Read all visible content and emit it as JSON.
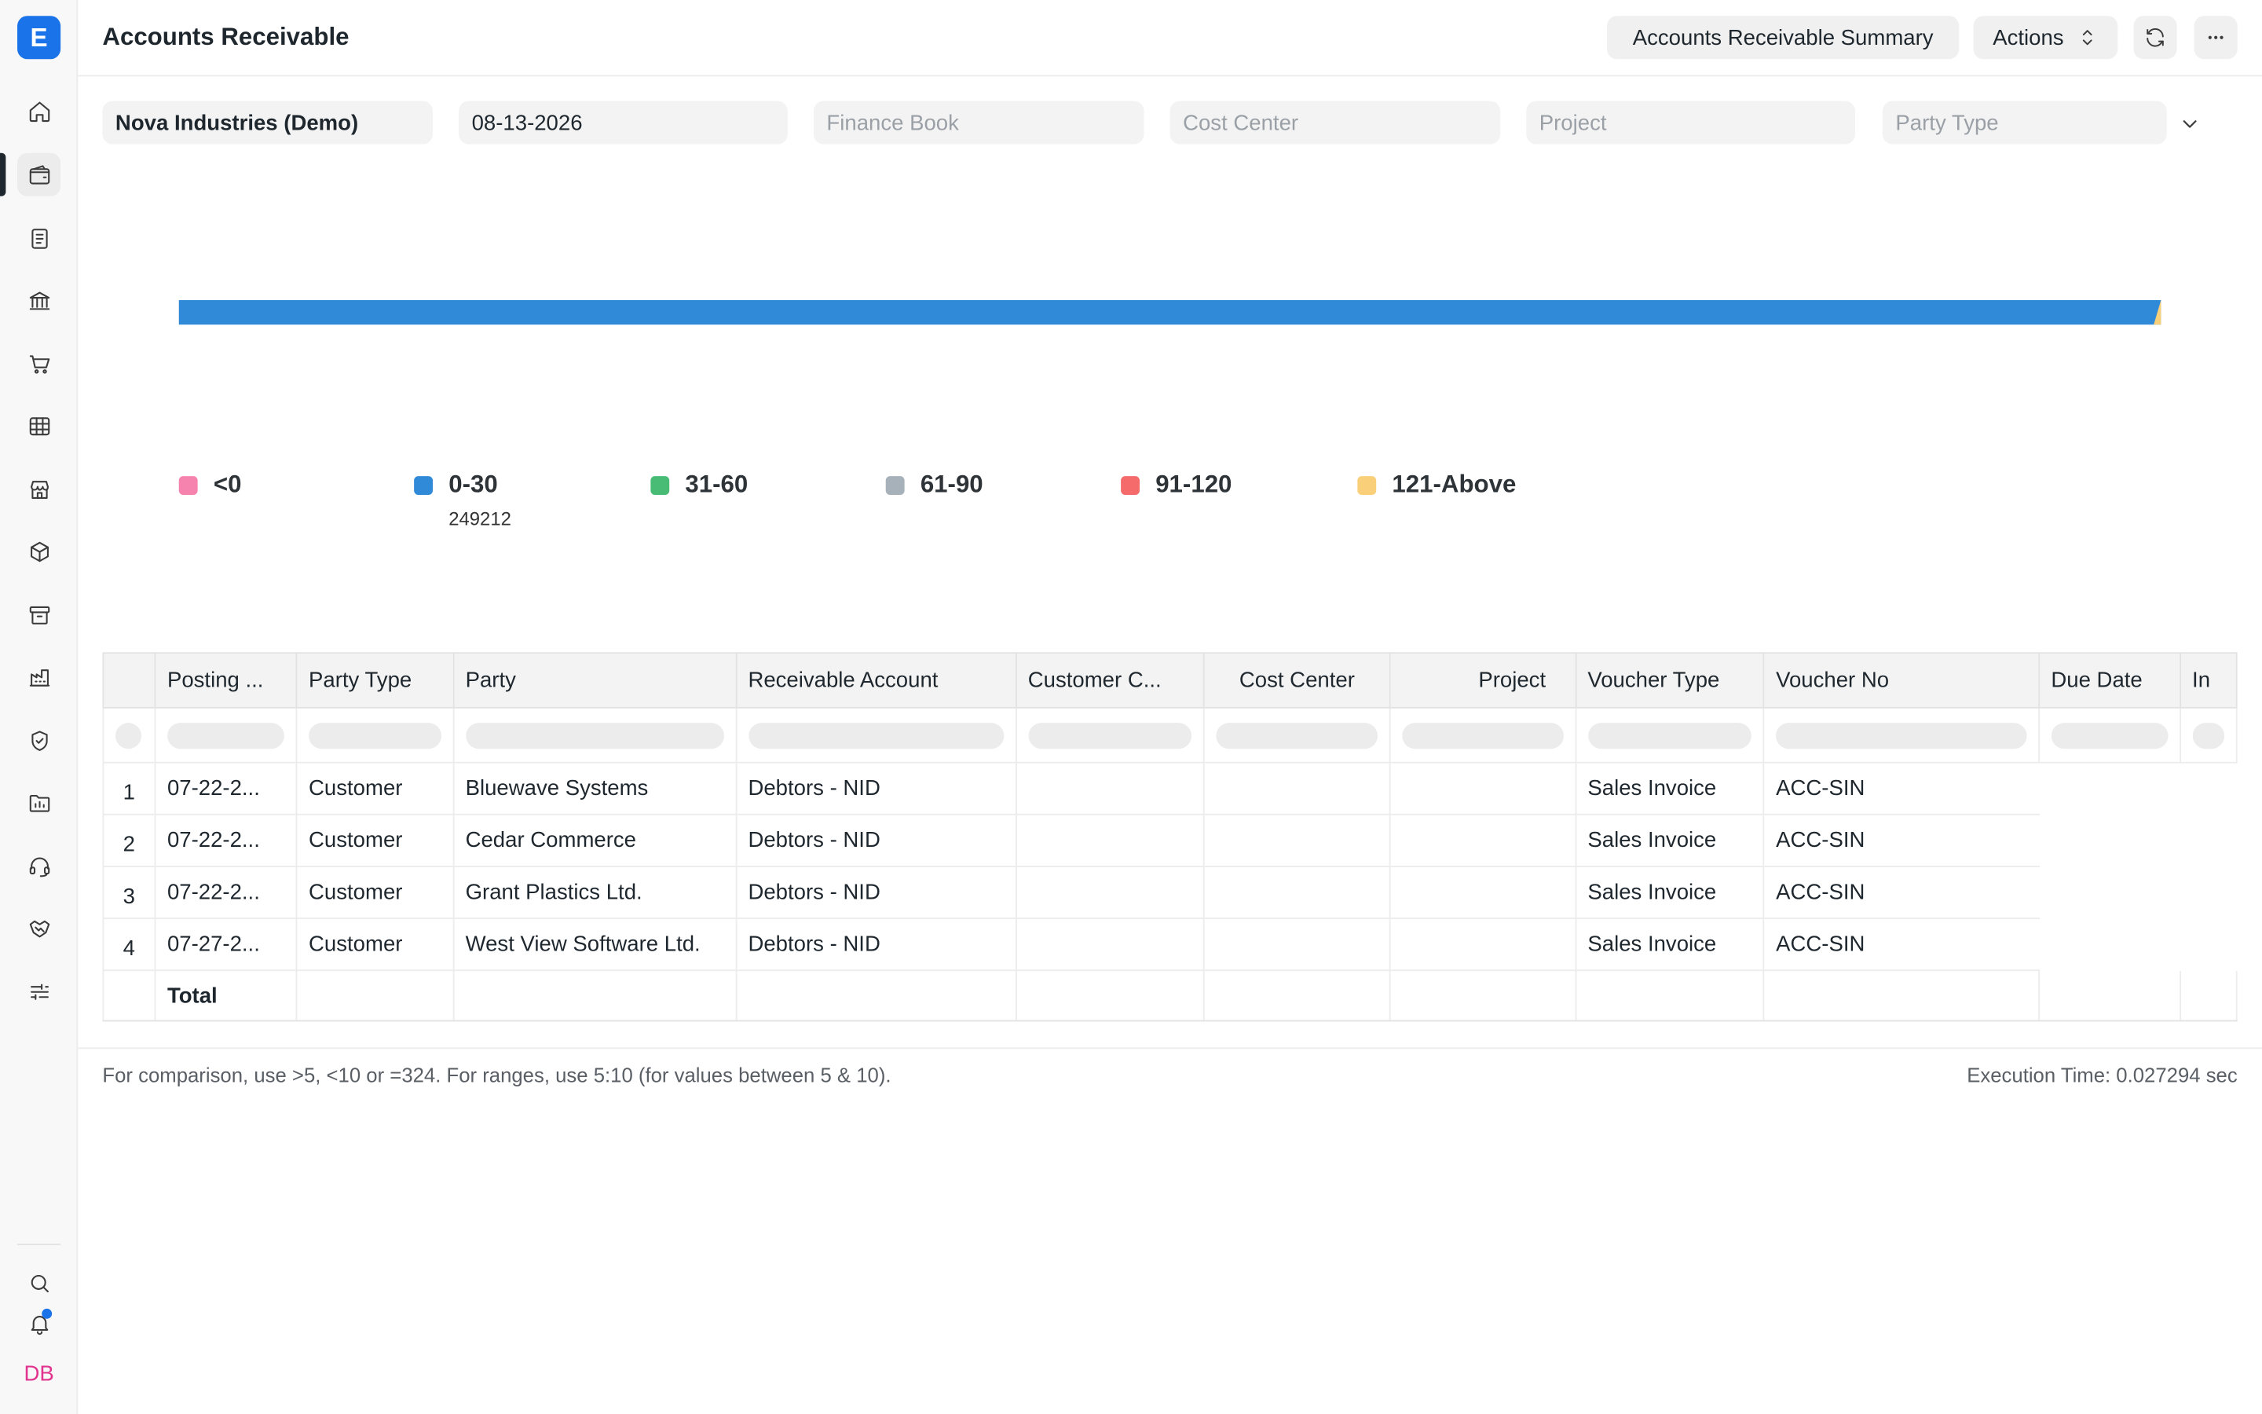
{
  "app": {
    "logo_letter": "E",
    "avatar_initials": "DB"
  },
  "header": {
    "title": "Accounts Receivable",
    "summary_button": "Accounts Receivable Summary",
    "actions_button": "Actions"
  },
  "filters": {
    "company": "Nova Industries (Demo)",
    "date": "08-13-2026",
    "finance_book_placeholder": "Finance Book",
    "cost_center_placeholder": "Cost Center",
    "project_placeholder": "Project",
    "party_type_placeholder": "Party Type"
  },
  "chart_data": {
    "type": "bar",
    "orientation": "horizontal-stacked",
    "series": [
      {
        "name": "<0",
        "value": 0,
        "color": "#f683ae"
      },
      {
        "name": "0-30",
        "value": 249212,
        "color": "#318ad8"
      },
      {
        "name": "31-60",
        "value": 0,
        "color": "#48bb74"
      },
      {
        "name": "61-90",
        "value": 0,
        "color": "#a6b1b9"
      },
      {
        "name": "91-120",
        "value": 0,
        "color": "#f56b6b"
      },
      {
        "name": "121-Above",
        "value": 0,
        "color": "#facf7a"
      }
    ],
    "legend": {
      "values_shown": {
        "0-30": "249212"
      }
    }
  },
  "table": {
    "columns": [
      "Posting ...",
      "Party Type",
      "Party",
      "Receivable Account",
      "Customer C...",
      "Cost Center",
      "Project",
      "Voucher Type",
      "Voucher No",
      "Due Date",
      "In"
    ],
    "rows": [
      {
        "num": "1",
        "posting": "07-22-2...",
        "party_type": "Customer",
        "party": "Bluewave Systems",
        "account": "Debtors - NID",
        "voucher_type": "Sales Invoice",
        "voucher_no": "ACC-SIN"
      },
      {
        "num": "2",
        "posting": "07-22-2...",
        "party_type": "Customer",
        "party": "Cedar Commerce",
        "account": "Debtors - NID",
        "voucher_type": "Sales Invoice",
        "voucher_no": "ACC-SIN"
      },
      {
        "num": "3",
        "posting": "07-22-2...",
        "party_type": "Customer",
        "party": "Grant Plastics Ltd.",
        "account": "Debtors - NID",
        "voucher_type": "Sales Invoice",
        "voucher_no": "ACC-SIN"
      },
      {
        "num": "4",
        "posting": "07-27-2...",
        "party_type": "Customer",
        "party": "West View Software Ltd.",
        "account": "Debtors - NID",
        "voucher_type": "Sales Invoice",
        "voucher_no": "ACC-SIN"
      }
    ],
    "total_label": "Total"
  },
  "footer": {
    "note": "For comparison, use >5, <10 or =324. For ranges, use 5:10 (for values between 5 & 10).",
    "execution_time": "Execution Time: 0.027294 sec"
  },
  "icons": [
    "home-icon",
    "wallet-icon",
    "file-text-icon",
    "bank-icon",
    "cart-icon",
    "table-icon",
    "store-icon",
    "box-icon",
    "archive-icon",
    "building-icon",
    "shield-icon",
    "folder-chart-icon",
    "headset-icon",
    "handshake-icon",
    "sliders-icon",
    "search-icon",
    "bell-icon"
  ]
}
